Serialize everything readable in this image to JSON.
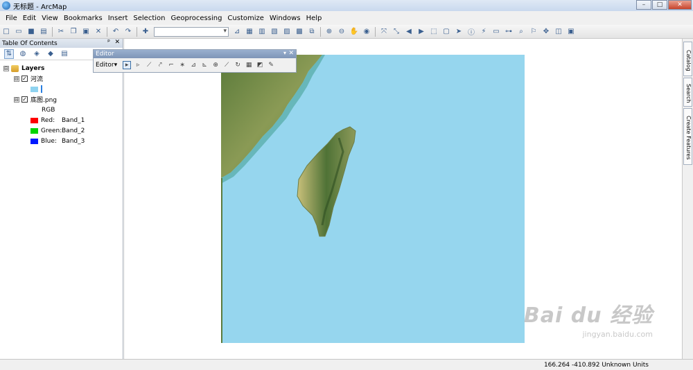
{
  "window": {
    "title": "无标题 - ArcMap",
    "controls": [
      "–",
      "□",
      "✕"
    ]
  },
  "menubar": [
    "File",
    "Edit",
    "View",
    "Bookmarks",
    "Insert",
    "Selection",
    "Geoprocessing",
    "Customize",
    "Windows",
    "Help"
  ],
  "toolbar": {
    "scale_value": ""
  },
  "toc": {
    "title": "Table Of Contents",
    "pin": "ᵖ",
    "close": "✕",
    "root": {
      "label": "Layers",
      "expander": "⊟"
    },
    "layers": [
      {
        "label": "河流",
        "checked": true,
        "expander": "⊟",
        "check_glyph": "✓",
        "legend": {
          "color": "#8fd3f0"
        }
      },
      {
        "label": "底图.png",
        "checked": true,
        "expander": "⊟",
        "check_glyph": "✓",
        "renderer": "RGB",
        "bands": [
          {
            "channel": "Red:",
            "band": "Band_1",
            "color": "#ff0000"
          },
          {
            "channel": "Green:",
            "band": "Band_2",
            "color": "#00d400"
          },
          {
            "channel": "Blue:",
            "band": "Band_3",
            "color": "#0018ff"
          }
        ]
      }
    ]
  },
  "editor": {
    "title": "Editor",
    "menu_label": "Editor▾",
    "dropdown": "▾",
    "close": "✕"
  },
  "right_dock": {
    "tabs": [
      "Catalog",
      "Search",
      "Create Features"
    ]
  },
  "status": {
    "coords": "166.264  -410.892 Unknown Units"
  },
  "watermark": {
    "main": "Bai du 经验",
    "sub": "jingyan.baidu.com"
  }
}
